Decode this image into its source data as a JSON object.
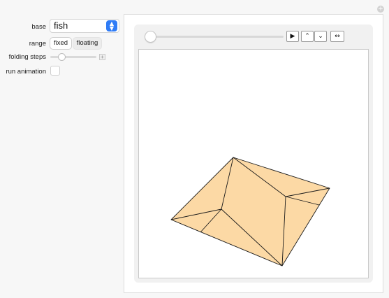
{
  "controls": {
    "base": {
      "label": "base",
      "value": "fish"
    },
    "range": {
      "label": "range",
      "options": [
        "fixed",
        "floating"
      ],
      "selected": "fixed"
    },
    "folding_steps": {
      "label": "folding steps",
      "value_fraction": 0.2
    },
    "run_animation": {
      "label": "run animation",
      "checked": false
    }
  },
  "animator": {
    "position_fraction": 0.0,
    "buttons": {
      "play": "▶",
      "faster": "⌃",
      "slower": "⌄",
      "direction": "↔"
    }
  },
  "graphic": {
    "fill_color": "#fcd9a5",
    "edge_color": "#1a1a1a"
  }
}
